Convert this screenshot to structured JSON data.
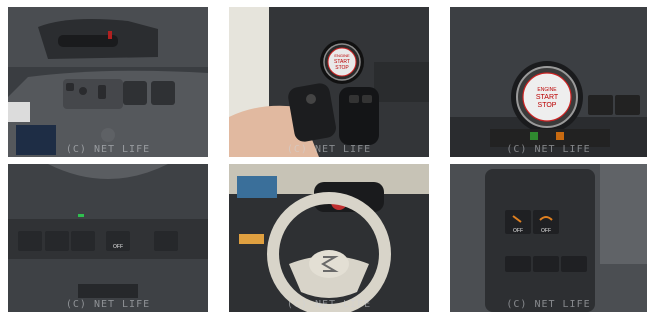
{
  "watermark": "(C) NET LIFE",
  "tiles": [
    {
      "name": "door-panel-window-switches"
    },
    {
      "name": "push-start-button-and-smart-keys"
    },
    {
      "name": "engine-start-stop-button-closeup"
    },
    {
      "name": "dashboard-switch-panel"
    },
    {
      "name": "steering-wheel-and-instrument-cluster"
    },
    {
      "name": "lower-dashboard-off-switches"
    }
  ],
  "button_text": {
    "line1": "ENGINE",
    "line2": "START",
    "line3": "STOP"
  },
  "switch_label": "OFF"
}
